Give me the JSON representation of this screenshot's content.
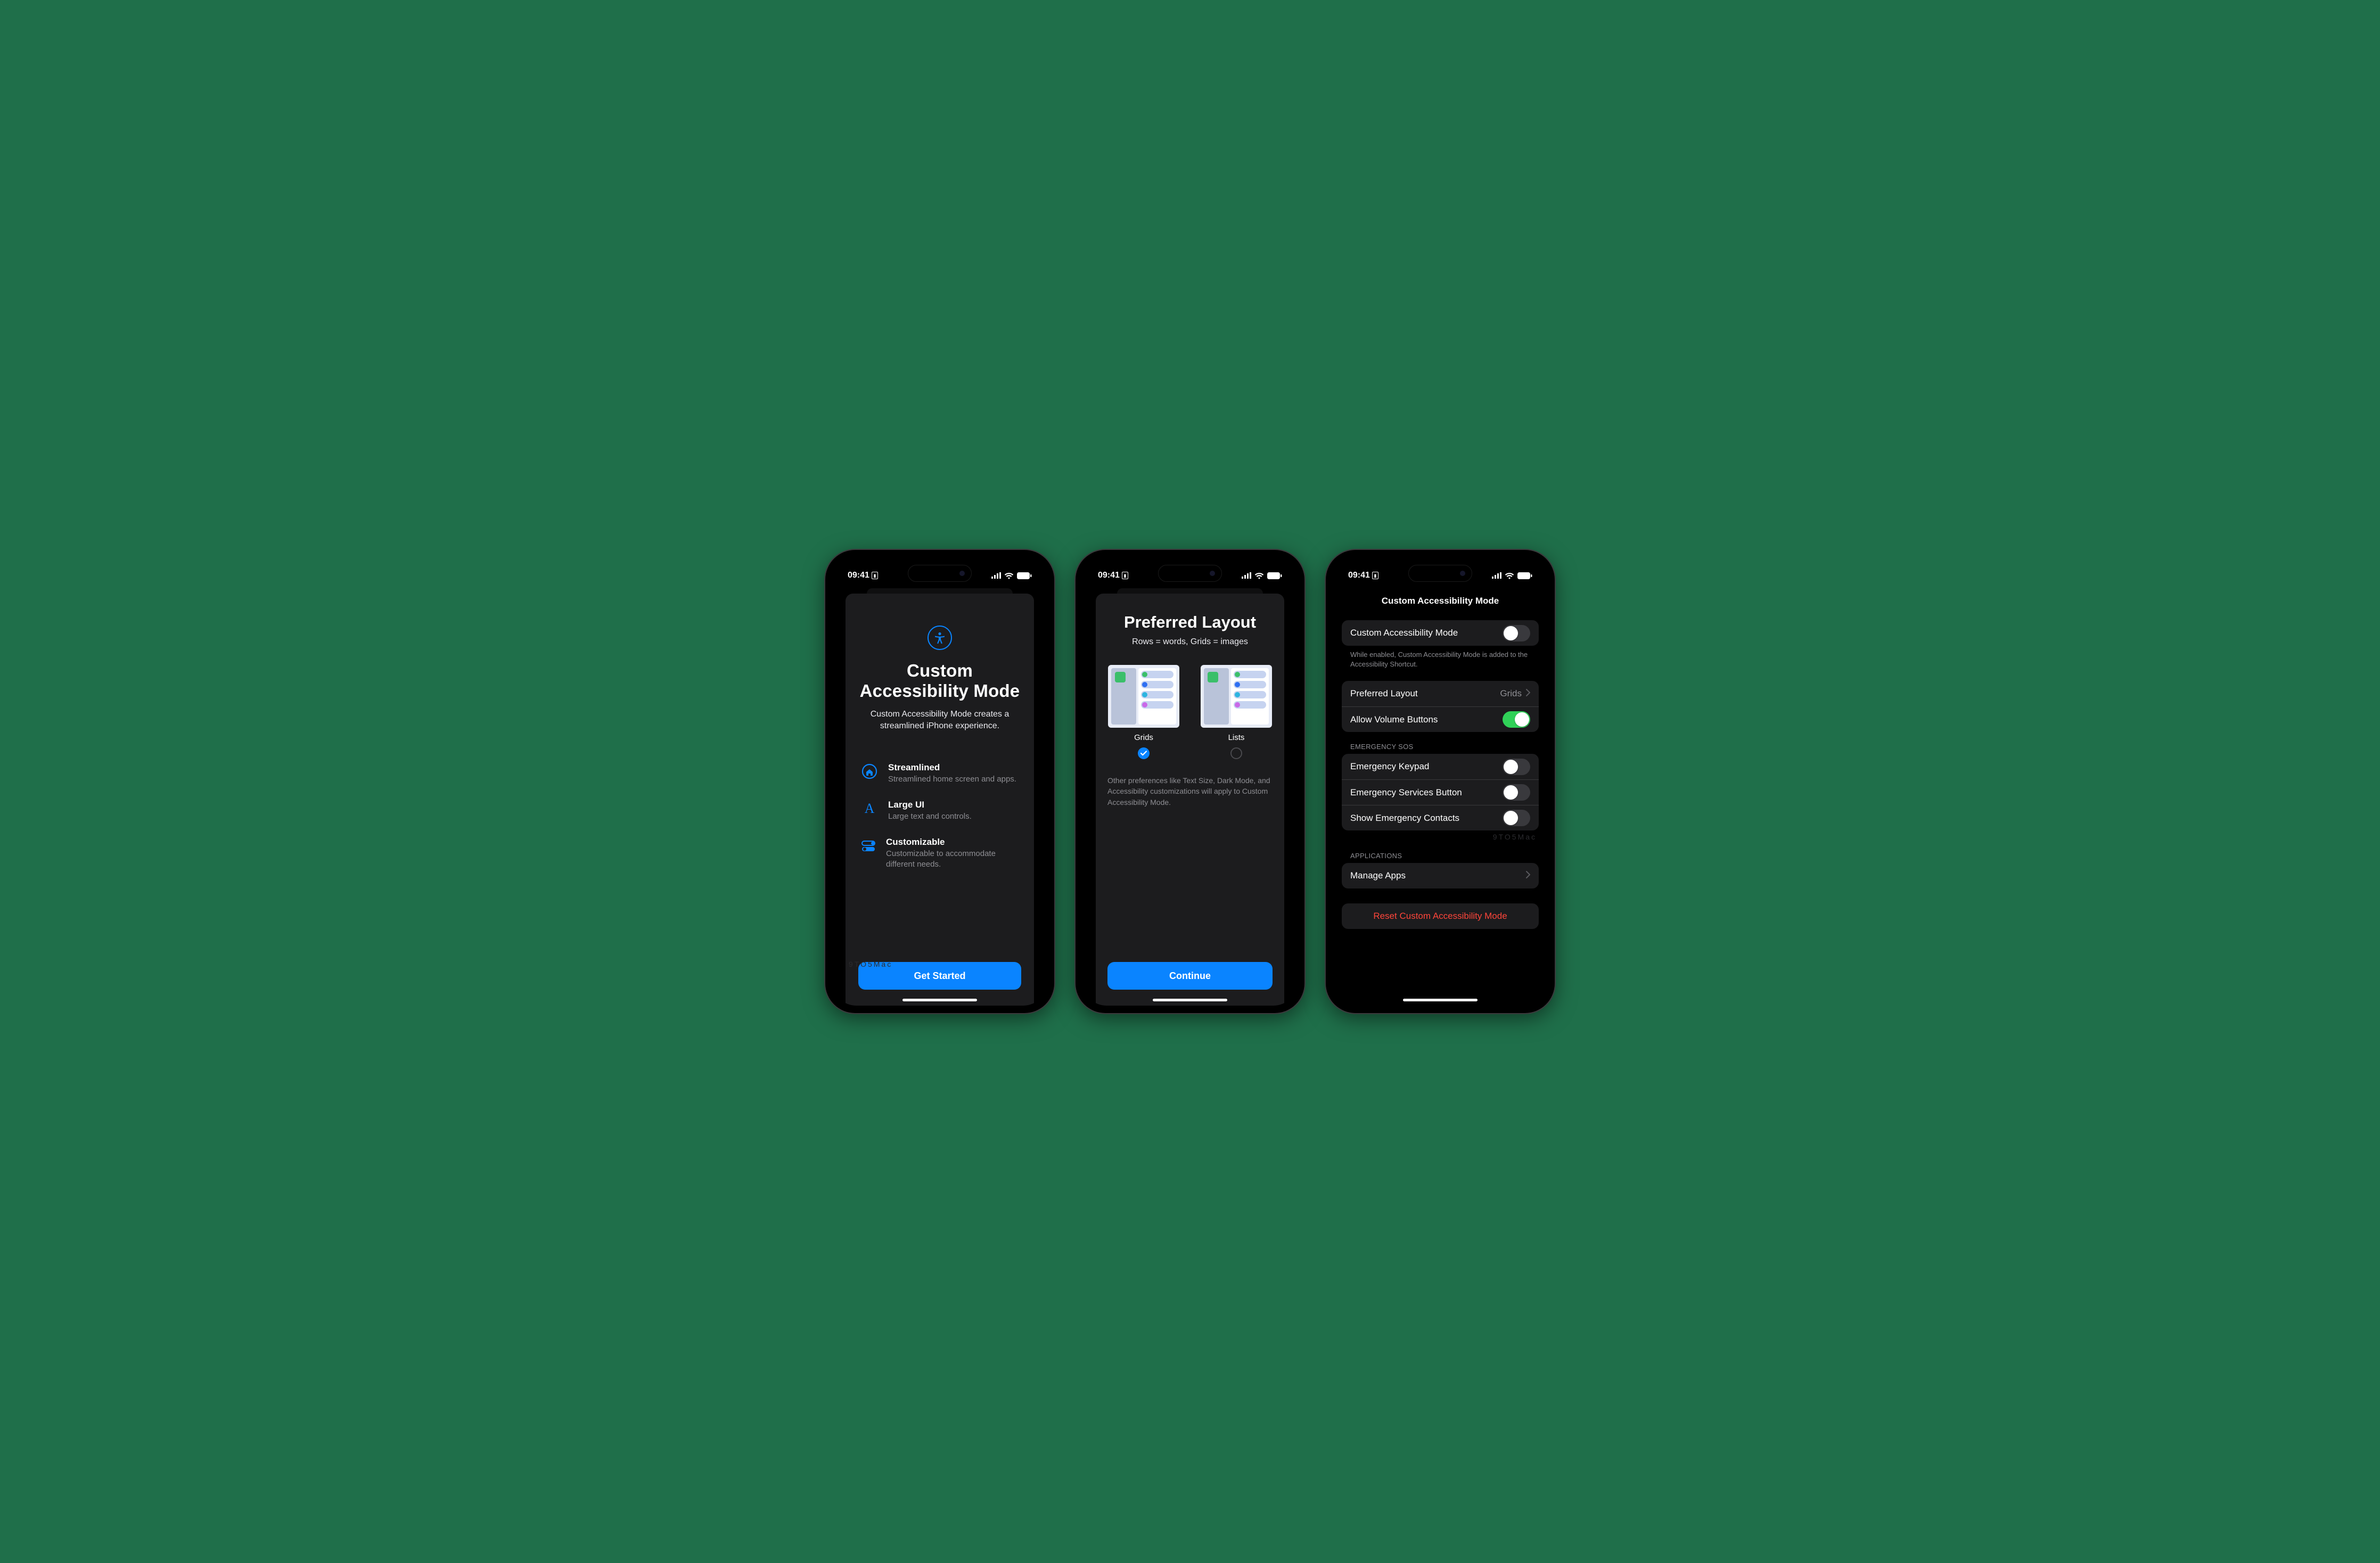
{
  "status": {
    "time": "09:41"
  },
  "screen1": {
    "title": "Custom Accessibility Mode",
    "subtitle": "Custom Accessibility Mode creates a streamlined iPhone experience.",
    "features": [
      {
        "title": "Streamlined",
        "desc": "Streamlined home screen and apps."
      },
      {
        "title": "Large UI",
        "desc": "Large text and controls."
      },
      {
        "title": "Customizable",
        "desc": "Customizable to accommodate different needs."
      }
    ],
    "button": "Get Started"
  },
  "screen2": {
    "title": "Preferred Layout",
    "subtitle": "Rows = words, Grids = images",
    "options": [
      {
        "label": "Grids",
        "selected": true
      },
      {
        "label": "Lists",
        "selected": false
      }
    ],
    "note": "Other preferences like Text Size, Dark Mode, and Accessibility customizations will apply to Custom Accessibility Mode.",
    "button": "Continue"
  },
  "screen3": {
    "header": "Custom Accessibility Mode",
    "mainToggle": {
      "label": "Custom Accessibility Mode",
      "on": false
    },
    "mainFooter": "While enabled, Custom Accessibility Mode is added to the Accessibility Shortcut.",
    "preferredLayout": {
      "label": "Preferred Layout",
      "value": "Grids"
    },
    "allowVolume": {
      "label": "Allow Volume Buttons",
      "on": true
    },
    "sosHeader": "EMERGENCY SOS",
    "sos": [
      {
        "label": "Emergency Keypad",
        "on": false
      },
      {
        "label": "Emergency Services Button",
        "on": false
      },
      {
        "label": "Show Emergency Contacts",
        "on": false
      }
    ],
    "appsHeader": "APPLICATIONS",
    "manageApps": "Manage Apps",
    "reset": "Reset Custom Accessibility Mode"
  }
}
